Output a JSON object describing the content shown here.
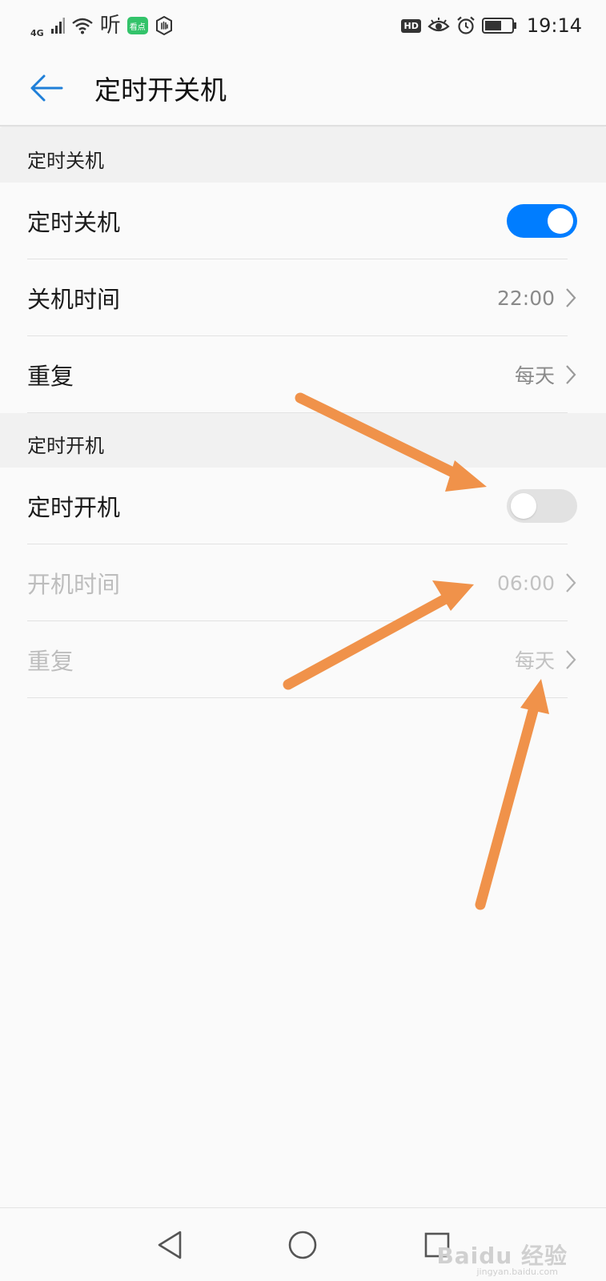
{
  "status_bar": {
    "network": "4G",
    "listen_label": "听",
    "app_badge": "看点",
    "hd_badge": "HD",
    "time": "19:14",
    "icons": [
      "signal-icon",
      "wifi-icon",
      "hand-icon",
      "eye-icon",
      "alarm-icon",
      "battery-icon"
    ]
  },
  "app_bar": {
    "title": "定时开关机",
    "back_icon": "arrow-left-icon"
  },
  "shutdown_section": {
    "header": "定时关机",
    "toggle_label": "定时关机",
    "toggle_on": true,
    "time_label": "关机时间",
    "time_value": "22:00",
    "repeat_label": "重复",
    "repeat_value": "每天"
  },
  "startup_section": {
    "header": "定时开机",
    "toggle_label": "定时开机",
    "toggle_on": false,
    "time_label": "开机时间",
    "time_value": "06:00",
    "repeat_label": "重复",
    "repeat_value": "每天"
  },
  "nav_bar": {
    "icons": [
      "back-triangle-icon",
      "home-circle-icon",
      "recents-square-icon"
    ]
  },
  "watermark": {
    "text": "Baidu 经验",
    "sub": "jingyan.baidu.com"
  },
  "colors": {
    "accent": "#007dff",
    "annotation_arrow": "#f0924a",
    "background": "#fafafa",
    "section_bg": "#f1f1f1"
  }
}
